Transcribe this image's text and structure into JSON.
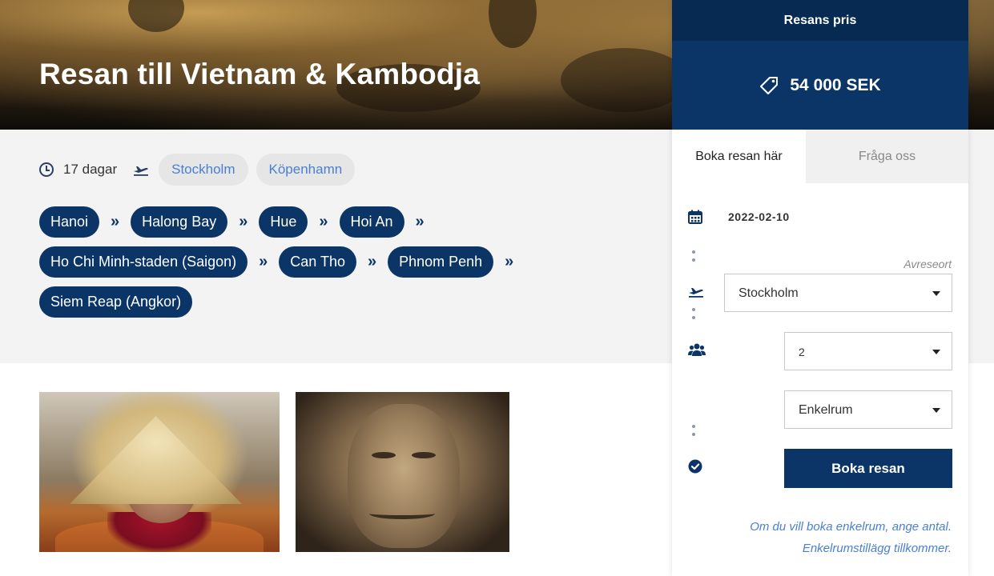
{
  "hero": {
    "title": "Resan till Vietnam & Kambodja"
  },
  "trip": {
    "duration": "17 dagar",
    "departure_cities": [
      "Stockholm",
      "Köpenhamn"
    ],
    "route": [
      "Hanoi",
      "Halong Bay",
      "Hue",
      "Hoi An",
      "Ho Chi Minh-staden (Saigon)",
      "Can Tho",
      "Phnom Penh",
      "Siem Reap (Angkor)"
    ],
    "separator": "»"
  },
  "booking": {
    "header": "Resans pris",
    "price": "54 000 SEK",
    "tabs": [
      {
        "label": "Boka resan här",
        "active": true
      },
      {
        "label": "Fråga oss",
        "active": false
      }
    ],
    "date": "2022-02-10",
    "departure_label": "Avreseort",
    "departure_value": "Stockholm",
    "travelers_value": "2",
    "room_value": "Enkelrum",
    "book_button": "Boka resan",
    "note_line1": "Om du vill boka enkelrum, ange antal.",
    "note_line2": "Enkelrumstillägg tillkommer."
  },
  "colors": {
    "navy": "#0b3566",
    "navy_dark": "#072a52",
    "link_blue": "#4a7fd1",
    "band_grey": "#f3f3f3"
  },
  "icons": {
    "duration": "clock-icon",
    "departure": "plane-departure-icon",
    "price": "price-tag-icon",
    "date": "calendar-icon",
    "travelers": "users-icon",
    "confirm": "check-circle-icon",
    "dropdown": "caret-down-icon"
  }
}
